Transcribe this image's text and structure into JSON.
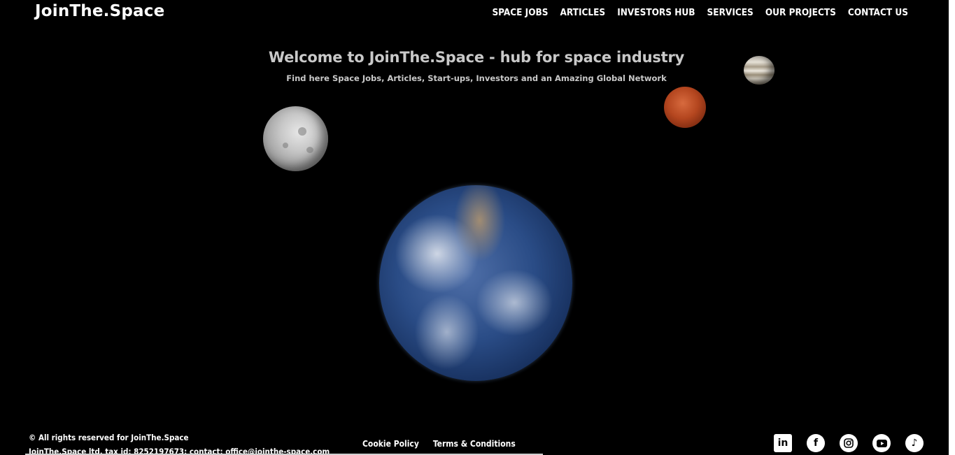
{
  "header": {
    "logo": "JoinThe.Space",
    "nav": [
      "SPACE JOBS",
      "ARTICLES",
      "INVESTORS HUB",
      "SERVICES",
      "OUR PROJECTS",
      "CONTACT US"
    ]
  },
  "hero": {
    "title": "Welcome to JoinThe.Space - hub for space industry",
    "subtitle": "Find here Space Jobs, Articles, Start-ups, Investors and an Amazing Global Network"
  },
  "footer": {
    "copyright": "© All rights reserved for JoinThe.Space",
    "company": "JoinThe.Space ltd, tax id: 8252197673; contact: office@jointhe-space.com",
    "links": [
      "Cookie Policy",
      "Terms & Conditions"
    ],
    "socials": [
      "linkedin-icon",
      "facebook-icon",
      "instagram-icon",
      "youtube-icon",
      "tiktok-icon"
    ]
  }
}
